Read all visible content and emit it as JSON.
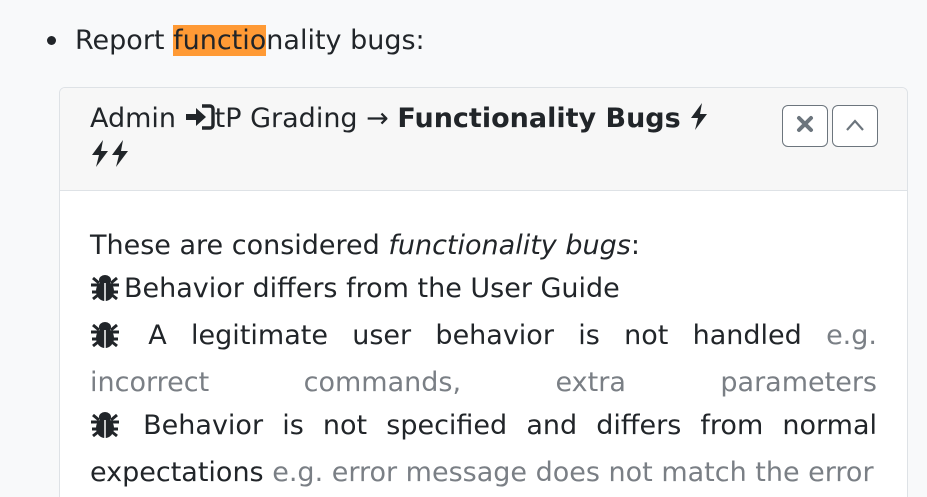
{
  "bullet": {
    "prefix": "Report ",
    "highlight": "functio",
    "suffix": "nality bugs:"
  },
  "card": {
    "title_prefix": "Admin",
    "title_middle": "tP Grading →",
    "title_bold": "Functionality Bugs",
    "close_icon": "close-icon",
    "collapse_icon": "chevron-up-icon",
    "intro_prefix": "These are considered ",
    "intro_italic": "functionality bugs",
    "intro_suffix": ":",
    "items": [
      {
        "icon": "bug-icon",
        "text": "Behavior differs from the User Guide",
        "example": ""
      },
      {
        "icon": "bug-icon",
        "text": "A legitimate user behavior is not handled",
        "example": "e.g. incorrect commands, extra parameters"
      },
      {
        "icon": "bug-icon",
        "text": "Behavior is not specified and differs from normal expectations",
        "example": "e.g. error message does not match the error"
      }
    ]
  },
  "colors": {
    "highlight": "#ff9a35",
    "muted": "#7a7f85",
    "text": "#212529"
  }
}
